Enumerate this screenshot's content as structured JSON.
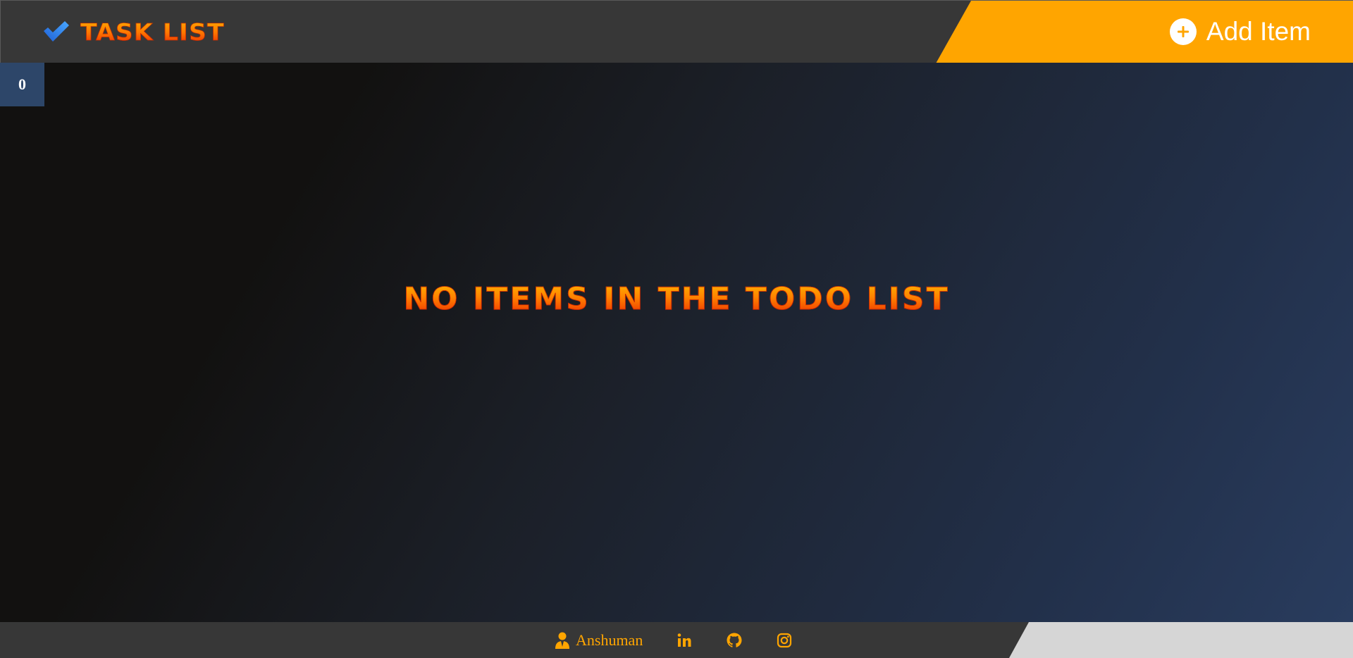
{
  "header": {
    "title": "Task List",
    "icon": "checkmark-icon",
    "add_button_label": "Add Item",
    "add_button_icon": "plus-circle-icon"
  },
  "main": {
    "item_count": "0",
    "empty_message": "No items in the todo list"
  },
  "footer": {
    "author_name": "Anshuman",
    "author_icon": "user-icon",
    "social_links": [
      "linkedin-icon",
      "github-icon",
      "instagram-icon"
    ]
  },
  "colors": {
    "accent": "#ffa500",
    "header_bg": "#373737",
    "counter_bg": "#2d4669",
    "checkmark_blue": "#2e86de"
  }
}
